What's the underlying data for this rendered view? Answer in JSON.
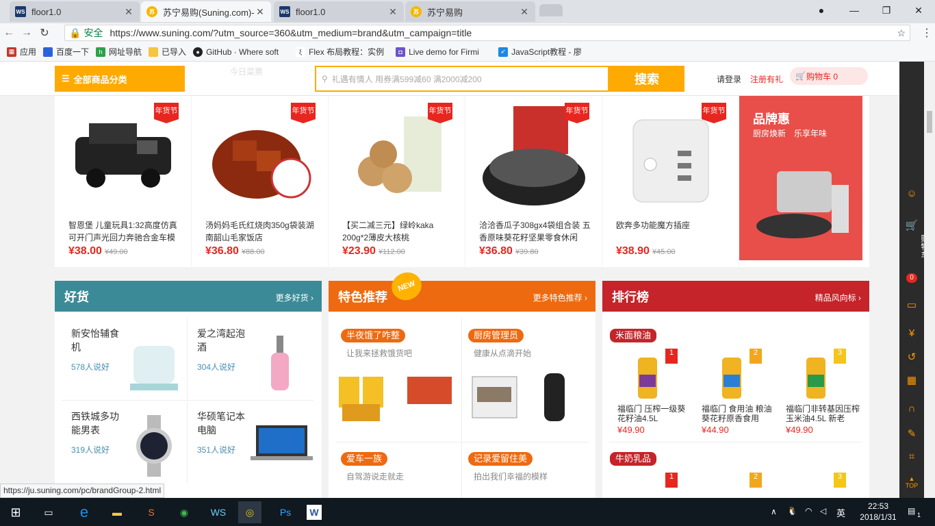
{
  "tabs": [
    {
      "icon": "WS",
      "title": "floor1.0",
      "active": false
    },
    {
      "icon": "苏",
      "title": "苏宁易购(Suning.com)-…",
      "active": true
    },
    {
      "icon": "WS",
      "title": "floor1.0",
      "active": false
    },
    {
      "icon": "苏",
      "title": "苏宁易购",
      "active": false
    }
  ],
  "address": {
    "secure_label": "安全",
    "url": "https://www.suning.com/?utm_source=360&utm_medium=brand&utm_campaign=title"
  },
  "bookmarks": [
    "应用",
    "百度一下",
    "网址导航",
    "已导入",
    "GitHub · Where soft",
    "Flex 布局教程：实例",
    "Live demo for Firmi",
    "JavaScript教程 - 廖"
  ],
  "header": {
    "category_label": "全部商品分类",
    "ghost_label": "今日菜票",
    "search_placeholder": "礼遇有情人 用券满599减60 满2000减200",
    "search_button": "搜索",
    "login": "请登录",
    "register": "注册有礼",
    "cart": "购物车 0"
  },
  "products": [
    {
      "badge": "年货节",
      "name": "智恩堡 儿童玩具1:32高度仿真可开门声光回力奔驰合金车模",
      "price": "¥38.00",
      "old": "¥49.00"
    },
    {
      "badge": "年货节",
      "name": "汤妈妈毛氏红烧肉350g袋装湖南韶山毛家饭店",
      "price": "¥36.80",
      "old": "¥88.00"
    },
    {
      "badge": "年货节",
      "name": "【买二减三元】绿岭kaka 200g*2薄皮大核桃",
      "price": "¥23.90",
      "old": "¥112.00"
    },
    {
      "badge": "年货节",
      "name": "洽洽香瓜子308gx4袋组合装 五香原味葵花籽坚果零食休闲",
      "price": "¥36.80",
      "old": "¥39.80"
    },
    {
      "badge": "年货节",
      "name": "欧奔多功能魔方插座",
      "price": "¥38.90",
      "old": "¥45.00"
    }
  ],
  "brand": {
    "title": "品牌惠",
    "subtitle": "厨房焕新　乐享年味"
  },
  "haohuo": {
    "title": "好货",
    "more": "更多好货",
    "items": [
      {
        "name": "新安怡辅食机",
        "count": "578人说好"
      },
      {
        "name": "爱之湾起泡酒",
        "count": "304人说好"
      },
      {
        "name": "西铁城多功能男表",
        "count": "319人说好"
      },
      {
        "name": "华硕笔记本电脑",
        "count": "351人说好"
      }
    ]
  },
  "tese": {
    "title": "特色推荐",
    "new_badge": "NEW",
    "more": "更多特色推荐",
    "items": [
      {
        "tag": "半夜饿了咋整",
        "sub": "让我来拯救饿货吧"
      },
      {
        "tag": "厨房管理员",
        "sub": "健康从点滴开始"
      },
      {
        "tag": "爱车一族",
        "sub": "自驾游说走就走"
      },
      {
        "tag": "记录爱留住美",
        "sub": "拍出我们幸福的模样"
      }
    ]
  },
  "ranking": {
    "title": "排行榜",
    "more": "精品风向标",
    "cat1": "米面粮油",
    "cat2": "牛奶乳品",
    "items": [
      {
        "rank": "1",
        "name": "福临门 压榨一级葵花籽油4.5L",
        "price": "¥49.90"
      },
      {
        "rank": "2",
        "name": "福临门 食用油 粮油 葵花籽原香食用",
        "price": "¥44.90"
      },
      {
        "rank": "3",
        "name": "福临门非转基因压榨玉米油4.5L 新老",
        "price": "¥49.90"
      }
    ],
    "ranks2": [
      "1",
      "2",
      "3"
    ]
  },
  "sidebar": {
    "cart_label": "购物车",
    "cart_count": "0",
    "top": "TOP"
  },
  "status_url": "https://ju.suning.com/pc/brandGroup-2.html",
  "taskbar": {
    "ime": "英",
    "time": "22:53",
    "date": "2018/1/31",
    "notif": "1"
  }
}
